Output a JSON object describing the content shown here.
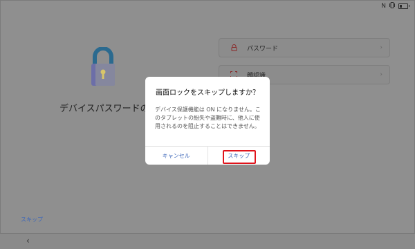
{
  "status_bar": {
    "nfc_symbol": "N",
    "icons": [
      "nfc-icon",
      "vibrate-icon",
      "battery-icon"
    ]
  },
  "background": {
    "title": "デバイスパスワードの設定",
    "skip_link": "スキップ",
    "options": [
      {
        "label": "パスワード",
        "icon": "lock-icon"
      },
      {
        "label": "顔認識",
        "icon": "face-icon"
      }
    ]
  },
  "dialog": {
    "title": "画面ロックをスキップしますか？",
    "message": "デバイス保護機能は ON になりません。このタブレットの紛失や盗難時に、他人に使用されるのを阻止することはできません。",
    "cancel_label": "キャンセル",
    "skip_label": "スキップ"
  },
  "colors": {
    "accent": "#3d67b9",
    "highlight": "#e0131b",
    "overlay": "#8f8f8f"
  }
}
